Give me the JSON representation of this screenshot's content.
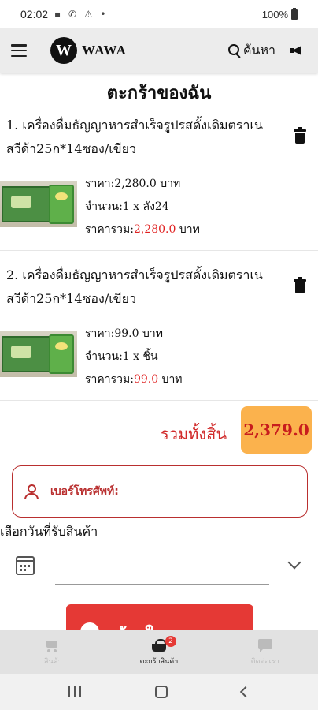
{
  "status_bar": {
    "time": "02:02",
    "left_icons": "▪ ✆ ⚠ •",
    "battery": "100%"
  },
  "app_bar": {
    "logo_letter": "W",
    "logo_text": "WAWA",
    "search_label": "ค้นหา"
  },
  "page_title": "ตะกร้าของฉัน",
  "items": [
    {
      "name": "1. เครื่องดื่มธัญญาหารสำเร็จรูปรสดั้งเดิมตราเนสวีด้า25ก*14ซอง/เขียว",
      "price": "ราคา:2,280.0 บาท",
      "qty": "จำนวน:1 x ลัง24",
      "total_prefix": "ราคารวม:",
      "total_value": "2,280.0",
      "total_suffix": " บาท"
    },
    {
      "name": "2. เครื่องดื่มธัญญาหารสำเร็จรูปรสดั้งเดิมตราเนสวีด้า25ก*14ซอง/เขียว",
      "price": "ราคา:99.0 บาท",
      "qty": "จำนวน:1 x ชิ้น",
      "total_prefix": "ราคารวม:",
      "total_value": "99.0",
      "total_suffix": " บาท"
    }
  ],
  "summary": {
    "label": "รวมทั้งสิ้น",
    "value": "2,379.0"
  },
  "phone_field": {
    "placeholder": "เบอร์โทรศัพท์:"
  },
  "date_section": {
    "label": "เลือกวันที่รับสินค้า"
  },
  "create_button": {
    "label": "สร้างใบเสนอราคา"
  },
  "bottom_nav": {
    "items": [
      {
        "label": "สินค้า"
      },
      {
        "label": "ตะกร้าสินค้า"
      },
      {
        "label": "ติดต่อเรา"
      }
    ],
    "cart_badge": "2"
  },
  "colors": {
    "accent_red": "#e53935",
    "total_box": "#fbb24d",
    "phone_border": "#b92f2f"
  }
}
